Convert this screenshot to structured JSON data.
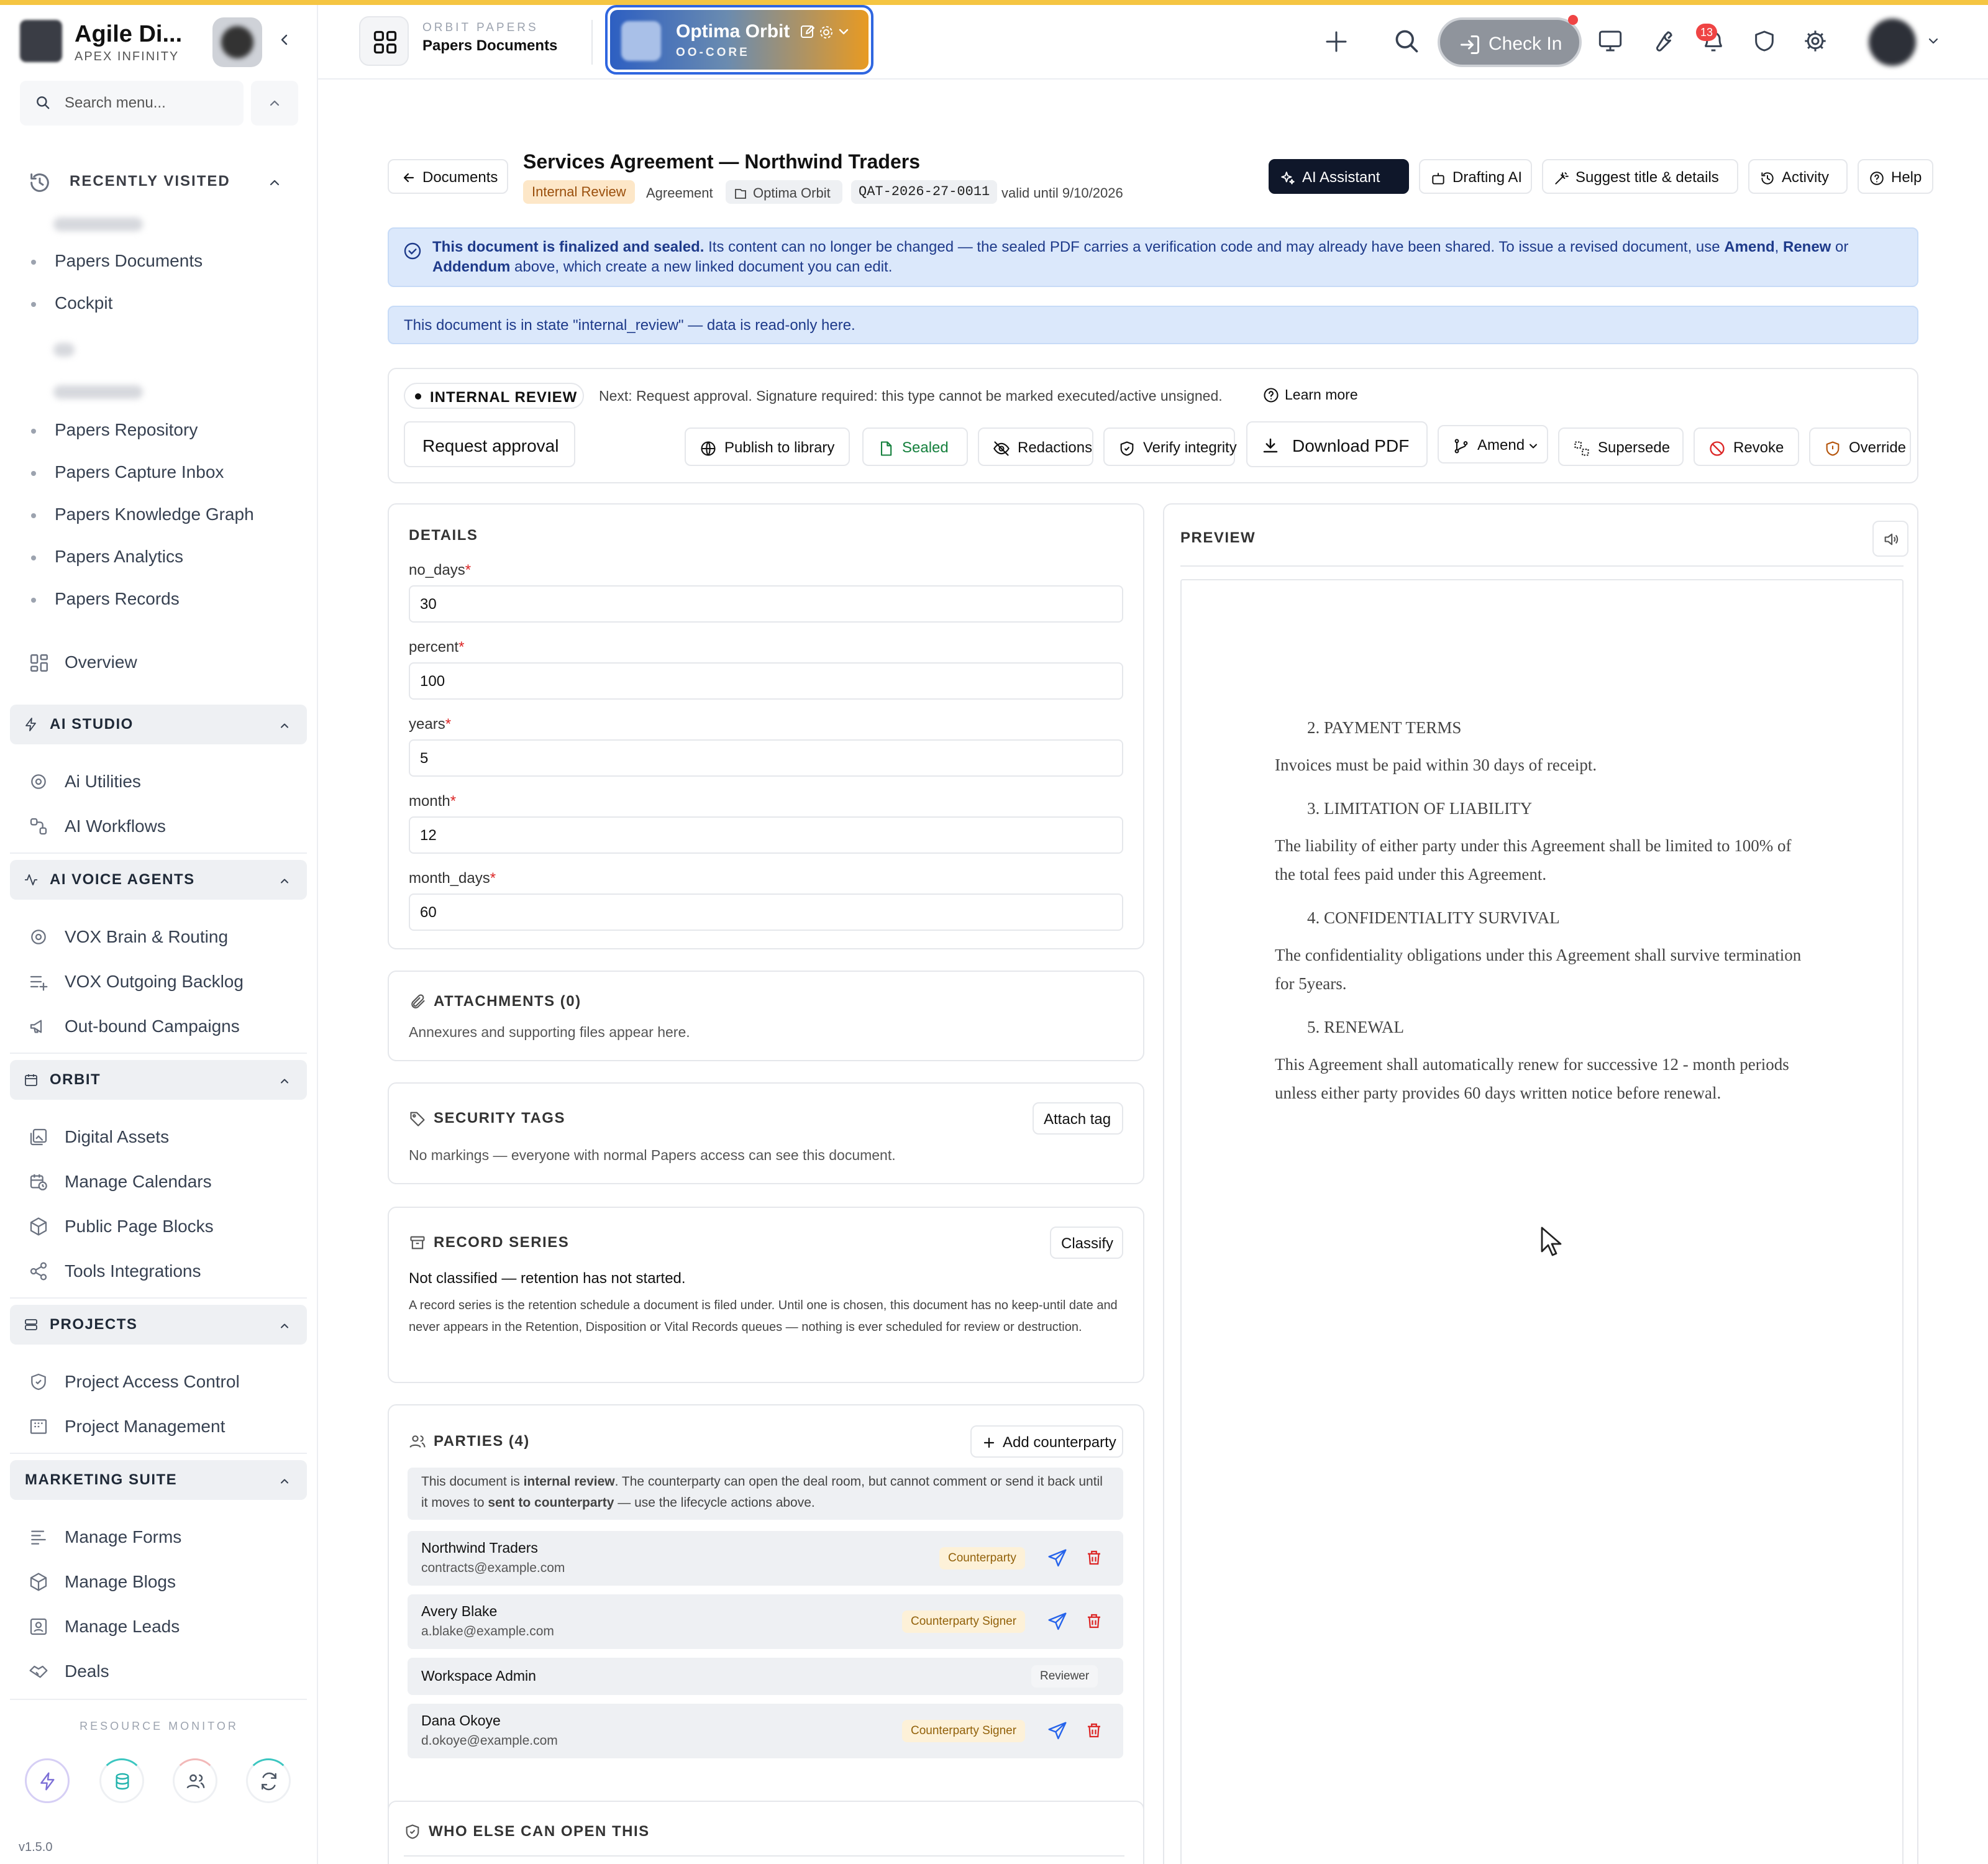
{
  "brand": {
    "name": "Agile Di...",
    "sub": "APEX INFINITY"
  },
  "search": {
    "placeholder": "Search menu..."
  },
  "recently_visited": {
    "title": "RECENTLY VISITED",
    "items": [
      "Papers Documents",
      "Cockpit",
      "Papers Repository",
      "Papers Capture Inbox",
      "Papers Knowledge Graph",
      "Papers Analytics",
      "Papers Records"
    ]
  },
  "nav": {
    "overview": "Overview",
    "groups": [
      {
        "title": "AI STUDIO",
        "items": [
          "Ai Utilities",
          "AI Workflows"
        ]
      },
      {
        "title": "AI VOICE AGENTS",
        "items": [
          "VOX Brain & Routing",
          "VOX Outgoing Backlog",
          "Out-bound Campaigns"
        ]
      },
      {
        "title": "ORBIT",
        "items": [
          "Digital Assets",
          "Manage Calendars",
          "Public Page Blocks",
          "Tools Integrations"
        ]
      },
      {
        "title": "PROJECTS",
        "items": [
          "Project Access Control",
          "Project Management"
        ]
      },
      {
        "title": "MARKETING SUITE",
        "items": [
          "Manage Forms",
          "Manage Blogs",
          "Manage Leads",
          "Deals"
        ]
      }
    ]
  },
  "resource_monitor": {
    "title": "RESOURCE MONITOR"
  },
  "version": "v1.5.0",
  "topbar": {
    "app_sub": "ORBIT PAPERS",
    "app_title": "Papers Documents",
    "workspace_name": "Optima Orbit",
    "workspace_code": "OO-CORE",
    "check_in": "Check In",
    "notifications": "13"
  },
  "header": {
    "back": "Documents",
    "title": "Services Agreement — Northwind Traders",
    "status": "Internal Review",
    "type": "Agreement",
    "tenant": "Optima Orbit",
    "code": "QAT-2026-27-0011",
    "valid": "valid until 9/10/2026",
    "buttons": {
      "ai_assistant": "AI Assistant",
      "drafting_ai": "Drafting AI",
      "suggest": "Suggest title & details",
      "activity": "Activity",
      "help": "Help"
    }
  },
  "alerts": {
    "sealed_bold": "This document is finalized and sealed.",
    "sealed_text": " Its content can no longer be changed — the sealed PDF carries a verification code and may already have been shared. To issue a revised document, use ",
    "amend": "Amend",
    "comma": ", ",
    "renew": "Renew",
    "or": " or ",
    "addendum": "Addendum",
    "tail": " above, which create a new linked document you can edit.",
    "readonly": "This document is in state \"internal_review\" — data is read-only here."
  },
  "lifecycle": {
    "state": "INTERNAL REVIEW",
    "next": "Next: Request approval. Signature required: this type cannot be marked executed/active unsigned.",
    "learn_more": "Learn more",
    "request_approval": "Request approval",
    "publish": "Publish to library",
    "sealed": "Sealed",
    "redactions": "Redactions",
    "verify": "Verify integrity",
    "download": "Download PDF",
    "amend": "Amend",
    "supersede": "Supersede",
    "revoke": "Revoke",
    "override": "Override"
  },
  "details": {
    "title": "DETAILS",
    "fields": [
      {
        "label": "no_days",
        "value": "30"
      },
      {
        "label": "percent",
        "value": "100"
      },
      {
        "label": "years",
        "value": "5"
      },
      {
        "label": "month",
        "value": "12"
      },
      {
        "label": "month_days",
        "value": "60"
      }
    ]
  },
  "attachments": {
    "title": "ATTACHMENTS (0)",
    "empty": "Annexures and supporting files appear here."
  },
  "security": {
    "title": "SECURITY TAGS",
    "button": "Attach tag",
    "text": "No markings — everyone with normal Papers access can see this document."
  },
  "record": {
    "title": "RECORD SERIES",
    "button": "Classify",
    "status": "Not classified — retention has not started.",
    "desc": "A record series is the retention schedule a document is filed under. Until one is chosen, this document has no keep-until date and never appears in the Retention, Disposition or Vital Records queues — nothing is ever scheduled for review or destruction."
  },
  "parties": {
    "title": "PARTIES (4)",
    "add": "Add counterparty",
    "note_a": "This document is ",
    "note_b": "internal review",
    "note_c": ". The counterparty can open the deal room, but cannot comment or send it back until it moves to ",
    "note_d": "sent to counterparty",
    "note_e": " — use the lifecycle actions above.",
    "list": [
      {
        "name": "Northwind Traders",
        "email": "contracts@example.com",
        "role": "Counterparty"
      },
      {
        "name": "Avery Blake",
        "email": "a.blake@example.com",
        "role": "Counterparty Signer"
      },
      {
        "name": "Workspace Admin",
        "email": "",
        "role": "Reviewer"
      },
      {
        "name": "Dana Okoye",
        "email": "d.okoye@example.com",
        "role": "Counterparty Signer"
      }
    ]
  },
  "who_else": {
    "title": "WHO ELSE CAN OPEN THIS"
  },
  "preview": {
    "title": "PREVIEW",
    "sections": [
      {
        "heading": "2. PAYMENT TERMS",
        "body": "Invoices must be paid within 30 days of receipt."
      },
      {
        "heading": "3. LIMITATION OF LIABILITY",
        "body": "The liability of either party under this Agreement shall be limited to 100% of the total fees paid under this Agreement."
      },
      {
        "heading": "4. CONFIDENTIALITY SURVIVAL",
        "body": "The confidentiality obligations under this Agreement shall survive termination for 5years."
      },
      {
        "heading": "5. RENEWAL",
        "body": "This Agreement shall automatically renew for successive 12 - month periods unless either party provides 60 days written notice before renewal."
      }
    ]
  }
}
